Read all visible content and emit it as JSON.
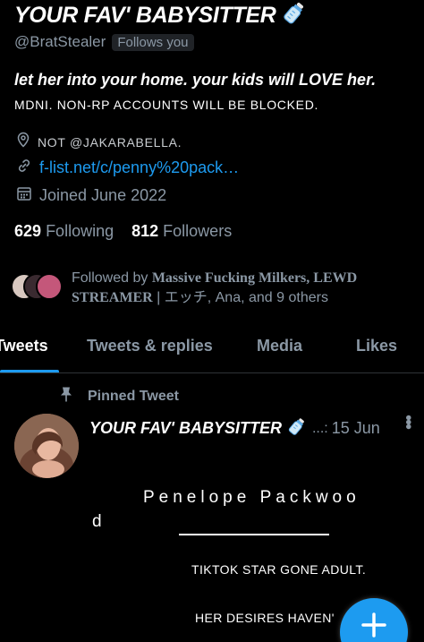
{
  "profile": {
    "display_name": "YOUR FAV' BABYSITTER",
    "name_emoji_icon": "baby-bottle-icon",
    "handle": "@BratStealer",
    "follows_you_badge": "Follows you",
    "bio_line_1": "let her into your home. your kids will LOVE her.",
    "bio_line_2": "MDNI. NON-RP ACCOUNTS WILL BE BLOCKED.",
    "location": "NOT @JAKARABELLA.",
    "link": "f-list.net/c/penny%20pack…",
    "joined": "Joined June 2022",
    "following_count": "629",
    "following_label": "Following",
    "followers_count": "812",
    "followers_label": "Followers"
  },
  "followed_by": {
    "prefix": "Followed by",
    "named_accounts": "Massive Fucking Milkers, LEWD STREAMER",
    "suffix": "| エッチ, Ana, and 9 others"
  },
  "tabs": [
    {
      "label": "Tweets",
      "active": true
    },
    {
      "label": "Tweets & replies",
      "active": false
    },
    {
      "label": "Media",
      "active": false
    },
    {
      "label": "Likes",
      "active": false
    }
  ],
  "pinned_tweet": {
    "pinned_label": "Pinned Tweet",
    "author_name": "YOUR FAV' BABYSITTER",
    "ellipsis": "...:",
    "date": "15 Jun",
    "media_title_part1": "Penelope Packwoo",
    "media_title_part2": "d",
    "media_line_1": "TIKTOK STAR GONE ADULT.",
    "media_line_2": "HER DESIRES HAVEN'"
  },
  "colors": {
    "accent": "#1d9bf0",
    "background": "#000000",
    "muted_text": "#8b98a5"
  }
}
